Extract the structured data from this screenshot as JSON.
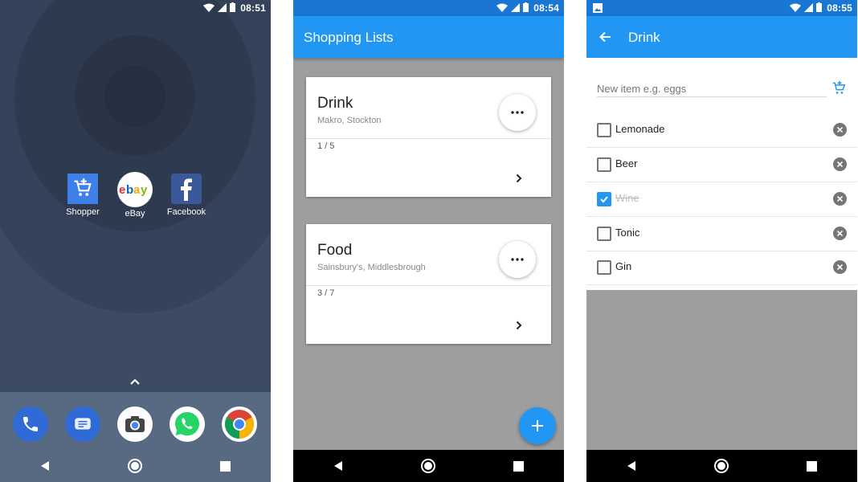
{
  "screen1": {
    "status": {
      "time": "08:51"
    },
    "apps": [
      {
        "name": "Shopper",
        "icon": "cart-plus-icon"
      },
      {
        "name": "eBay",
        "icon": "ebay-logo-icon"
      },
      {
        "name": "Facebook",
        "icon": "facebook-logo-icon"
      }
    ],
    "dock": [
      "phone-icon",
      "messages-icon",
      "camera-icon",
      "whatsapp-icon",
      "chrome-icon"
    ]
  },
  "screen2": {
    "status": {
      "time": "08:54"
    },
    "title": "Shopping Lists",
    "lists": [
      {
        "name": "Drink",
        "store": "Makro, Stockton",
        "count": "1 / 5"
      },
      {
        "name": "Food",
        "store": "Sainsbury's, Middlesbrough",
        "count": "3 / 7"
      }
    ]
  },
  "screen3": {
    "status": {
      "time": "08:55"
    },
    "title": "Drink",
    "new_item_placeholder": "New item e.g. eggs",
    "items": [
      {
        "label": "Lemonade",
        "checked": false
      },
      {
        "label": "Beer",
        "checked": false
      },
      {
        "label": "Wine",
        "checked": true
      },
      {
        "label": "Tonic",
        "checked": false
      },
      {
        "label": "Gin",
        "checked": false
      }
    ]
  },
  "colors": {
    "primary": "#2196f3",
    "wallpaper": "#3c4b63",
    "dock": "#586a82"
  }
}
